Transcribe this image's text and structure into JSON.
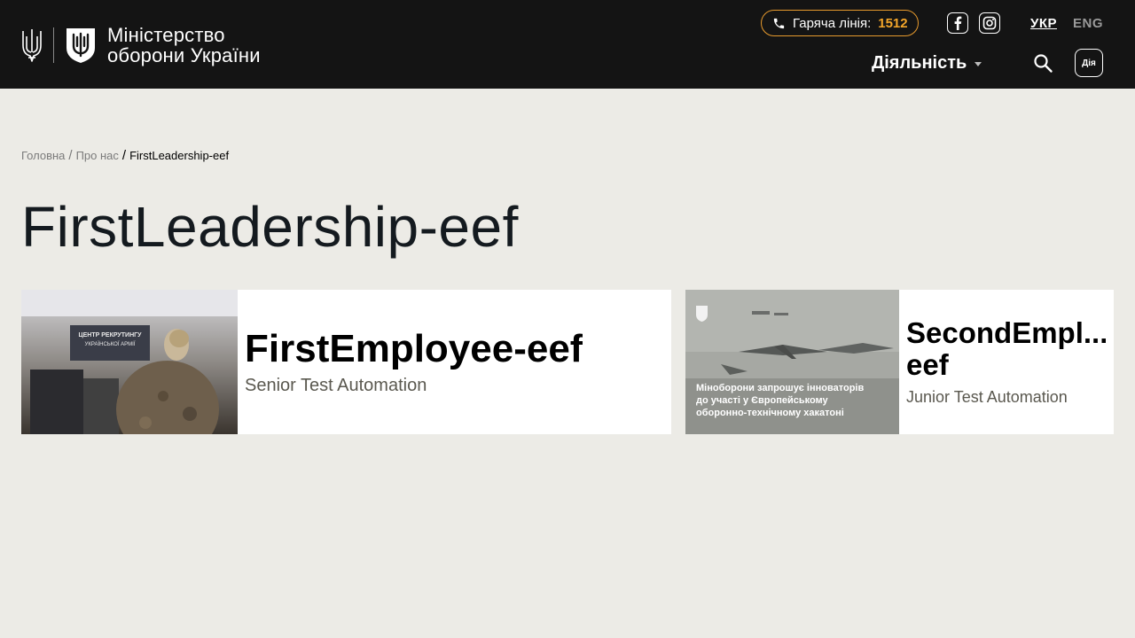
{
  "header": {
    "logo": {
      "line1": "Міністерство",
      "line2": "оборони України"
    },
    "hotline": {
      "label": "Гаряча лінія:",
      "number": "1512",
      "accent_color": "#f4a62a"
    },
    "social": [
      {
        "name": "facebook",
        "icon": "facebook-icon"
      },
      {
        "name": "instagram",
        "icon": "instagram-icon"
      }
    ],
    "languages": {
      "active": "УКР",
      "other": "ENG"
    },
    "nav": {
      "activity_label": "Діяльність"
    },
    "search_icon": "search-icon",
    "diia_label": "Дія"
  },
  "breadcrumb": {
    "home": "Головна",
    "about": "Про нас",
    "current": "FirstLeadership-eef"
  },
  "page": {
    "title": "FirstLeadership-eef"
  },
  "cards": [
    {
      "name": "FirstEmployee-eef",
      "role": "Senior Test Automation",
      "image_text": [
        "ЦЕНТР РЕКРУТИНГУ",
        "УКРАЇНСЬКОЇ АРМІЇ"
      ]
    },
    {
      "name_line1": "SecondEmpl...",
      "name_line2": "eef",
      "role": "Junior Test Automation",
      "image_text": [
        "Міноборони запрошує інноваторів",
        "до участі у Європейському",
        "оборонно-технічному хакатоні"
      ]
    }
  ],
  "colors": {
    "header_bg": "#141414",
    "page_bg": "#ecebe6",
    "hotline_border": "#e79a2d"
  }
}
